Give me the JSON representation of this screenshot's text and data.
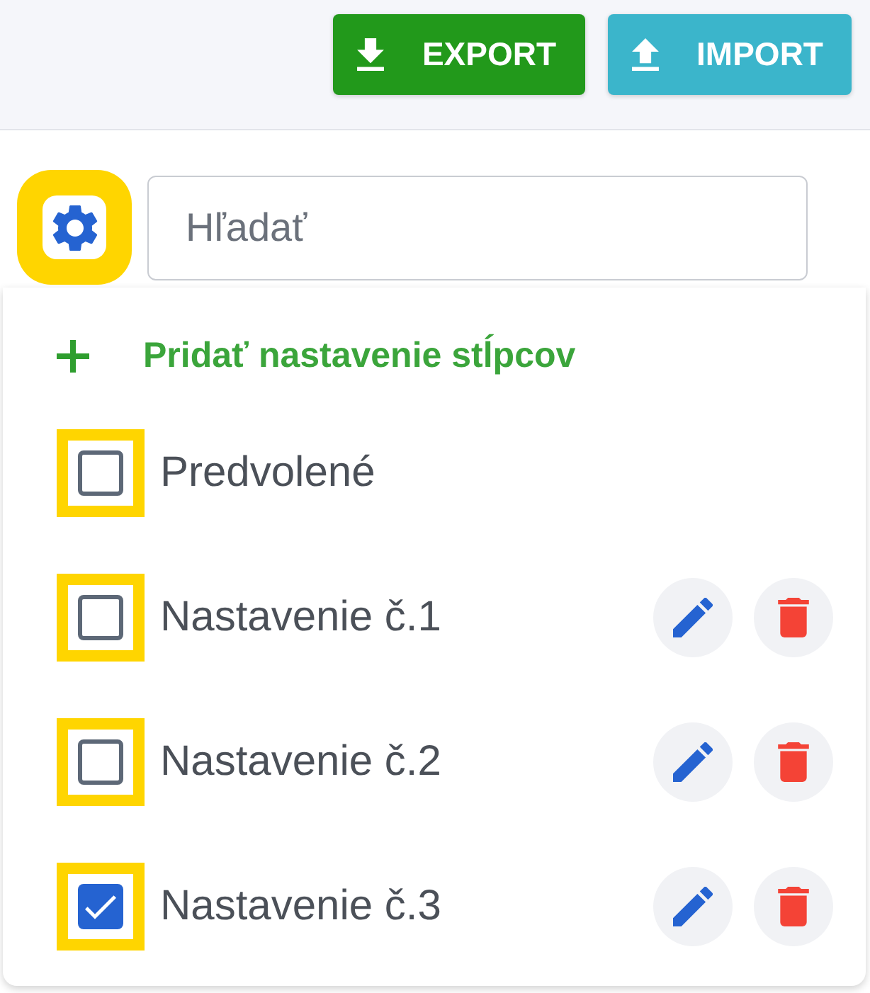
{
  "toolbar": {
    "buttons": [
      {
        "kind": "export",
        "label": "EXPORT"
      },
      {
        "kind": "import",
        "label": "IMPORT"
      }
    ]
  },
  "search": {
    "placeholder": "Hľadať"
  },
  "column_settings": {
    "add_label": "Pridať nastavenie stĺpcov",
    "items": [
      {
        "kind": "default",
        "label": "Predvolené",
        "checked": false
      },
      {
        "kind": "custom",
        "label": "Nastavenie č.1",
        "checked": false
      },
      {
        "kind": "custom",
        "label": "Nastavenie č.2",
        "checked": false
      },
      {
        "kind": "custom",
        "label": "Nastavenie č.3",
        "checked": true
      }
    ]
  }
}
